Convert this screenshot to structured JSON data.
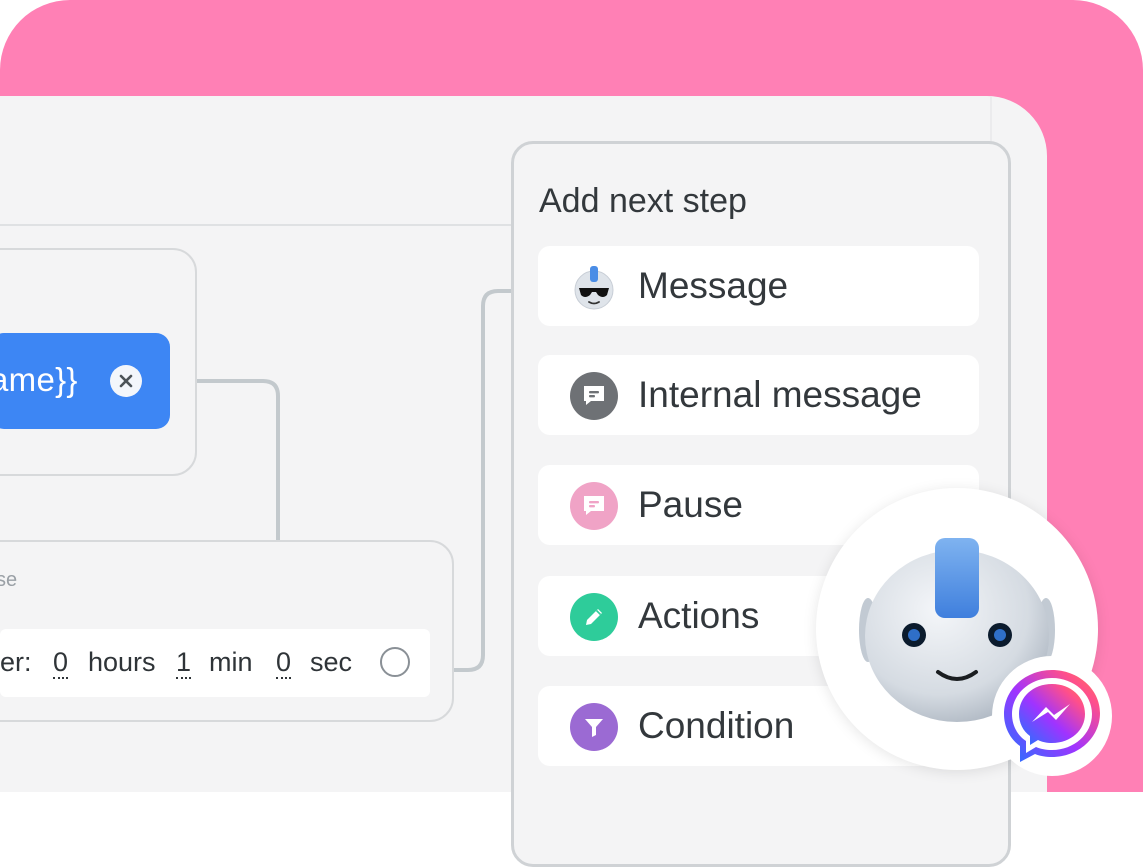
{
  "colors": {
    "background": "#ff80b5",
    "canvas": "#f4f4f5",
    "accent_blue": "#3d86f4",
    "action_green": "#2ecc9a",
    "condition_purple": "#9b6ad3",
    "pause_pink": "#f0a3c6",
    "internal_gray": "#6e7175"
  },
  "node1": {
    "variable_text": "ame}}",
    "remove_icon": "close-circle-icon"
  },
  "node2": {
    "label": "se",
    "delay": {
      "prefix": "er:",
      "hours_value": "0",
      "hours_unit": "hours",
      "min_value": "1",
      "min_unit": "min",
      "sec_value": "0",
      "sec_unit": "sec"
    }
  },
  "panel": {
    "title": "Add next step",
    "steps": [
      {
        "label": "Message",
        "icon": "robot-sunglasses-icon"
      },
      {
        "label": "Internal message",
        "icon": "chat-bubble-icon"
      },
      {
        "label": "Pause",
        "icon": "chat-bubble-icon"
      },
      {
        "label": "Actions",
        "icon": "pencil-icon"
      },
      {
        "label": "Condition",
        "icon": "funnel-icon"
      }
    ]
  },
  "badges": {
    "bot": "robot-mascot-icon",
    "messenger": "messenger-icon"
  }
}
